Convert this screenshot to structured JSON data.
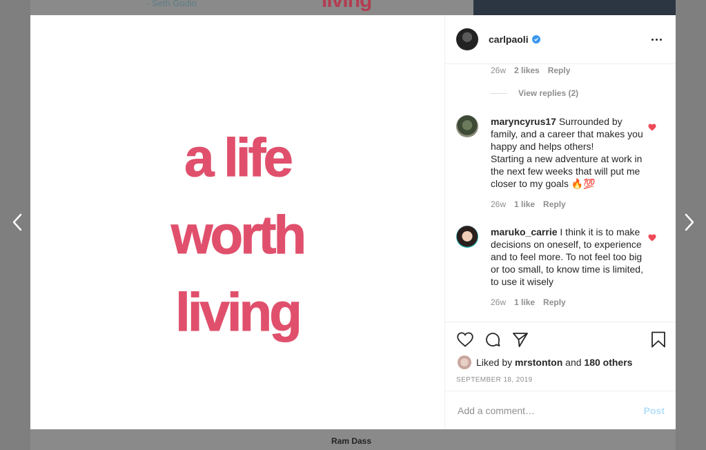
{
  "background": {
    "top_quote": "- Seth Godin",
    "top_word": "living",
    "bottom_text": "Ram Dass"
  },
  "post": {
    "image_lines": [
      "a life",
      "worth",
      "living"
    ],
    "image_color": "#e0506c",
    "owner": {
      "username": "carlpaoli",
      "verified": true
    },
    "previous_comment_meta": {
      "time": "26w",
      "likes": "2 likes",
      "reply": "Reply"
    },
    "view_replies": "View replies (2)",
    "comments": [
      {
        "username": "maryncyrus17",
        "text_lines": [
          "Surrounded by family, and a career that makes you happy and helps others!",
          "Starting a new adventure at work in the next few weeks that will put me closer to my goals 🔥💯"
        ],
        "time": "26w",
        "likes": "1 like",
        "reply": "Reply",
        "liked": true
      },
      {
        "username": "maruko_carrie",
        "text_lines": [
          "I think it is to make decisions on oneself, to experience and to feel more. To not feel too big or too small, to know time is limited, to use it wisely"
        ],
        "time": "26w",
        "likes": "1 like",
        "reply": "Reply",
        "liked": true
      }
    ],
    "liked_by": {
      "prefix": "Liked by",
      "user": "mrstonton",
      "joiner": "and",
      "others": "180 others"
    },
    "date": "SEPTEMBER 18, 2019",
    "comment_placeholder": "Add a comment…",
    "post_label": "Post"
  },
  "colors": {
    "accent_blue": "#3897f0",
    "heart_red": "#ed4956",
    "post_disabled": "#b2dffc"
  },
  "icons": [
    "chevron-left-icon",
    "chevron-right-icon",
    "verified-badge-icon",
    "more-options-icon",
    "heart-icon",
    "comment-icon",
    "share-icon",
    "bookmark-icon",
    "heart-filled-icon"
  ]
}
